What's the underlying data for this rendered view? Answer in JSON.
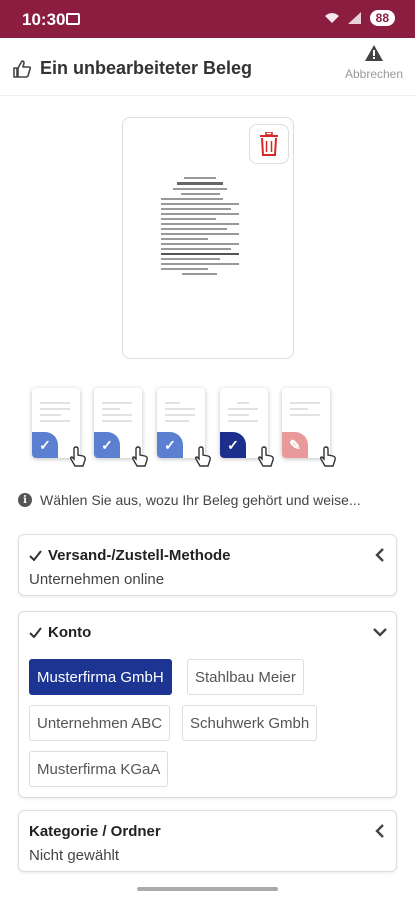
{
  "status_bar": {
    "time": "10:30",
    "battery": "88"
  },
  "header": {
    "title": "Ein unbearbeiteter Beleg",
    "cancel_label": "Abbrechen"
  },
  "thumbnails": [
    {
      "state": "checked",
      "tag_color": "#5b7fd1"
    },
    {
      "state": "checked",
      "tag_color": "#5b7fd1"
    },
    {
      "state": "checked",
      "tag_color": "#5b7fd1"
    },
    {
      "state": "checked-active",
      "tag_color": "#1c2f8c"
    },
    {
      "state": "editing",
      "tag_color": "#e89a9a"
    }
  ],
  "info_text": "Wählen Sie aus, wozu Ihr Beleg gehört und weise...",
  "sections": {
    "versand": {
      "title": "Versand-/Zustell-Methode",
      "value": "Unternehmen online"
    },
    "konto": {
      "title": "Konto",
      "options": [
        "Musterfirma GmbH",
        "Stahlbau Meier",
        "Unternehmen ABC",
        "Schuhwerk Gmbh",
        "Musterfirma KGaA"
      ],
      "selected": "Musterfirma GmbH"
    },
    "kategorie": {
      "title": "Kategorie / Ordner",
      "value": "Nicht gewählt"
    }
  },
  "colors": {
    "brand": "#8b1d41",
    "accent": "#1c3593",
    "danger": "#d62828"
  }
}
